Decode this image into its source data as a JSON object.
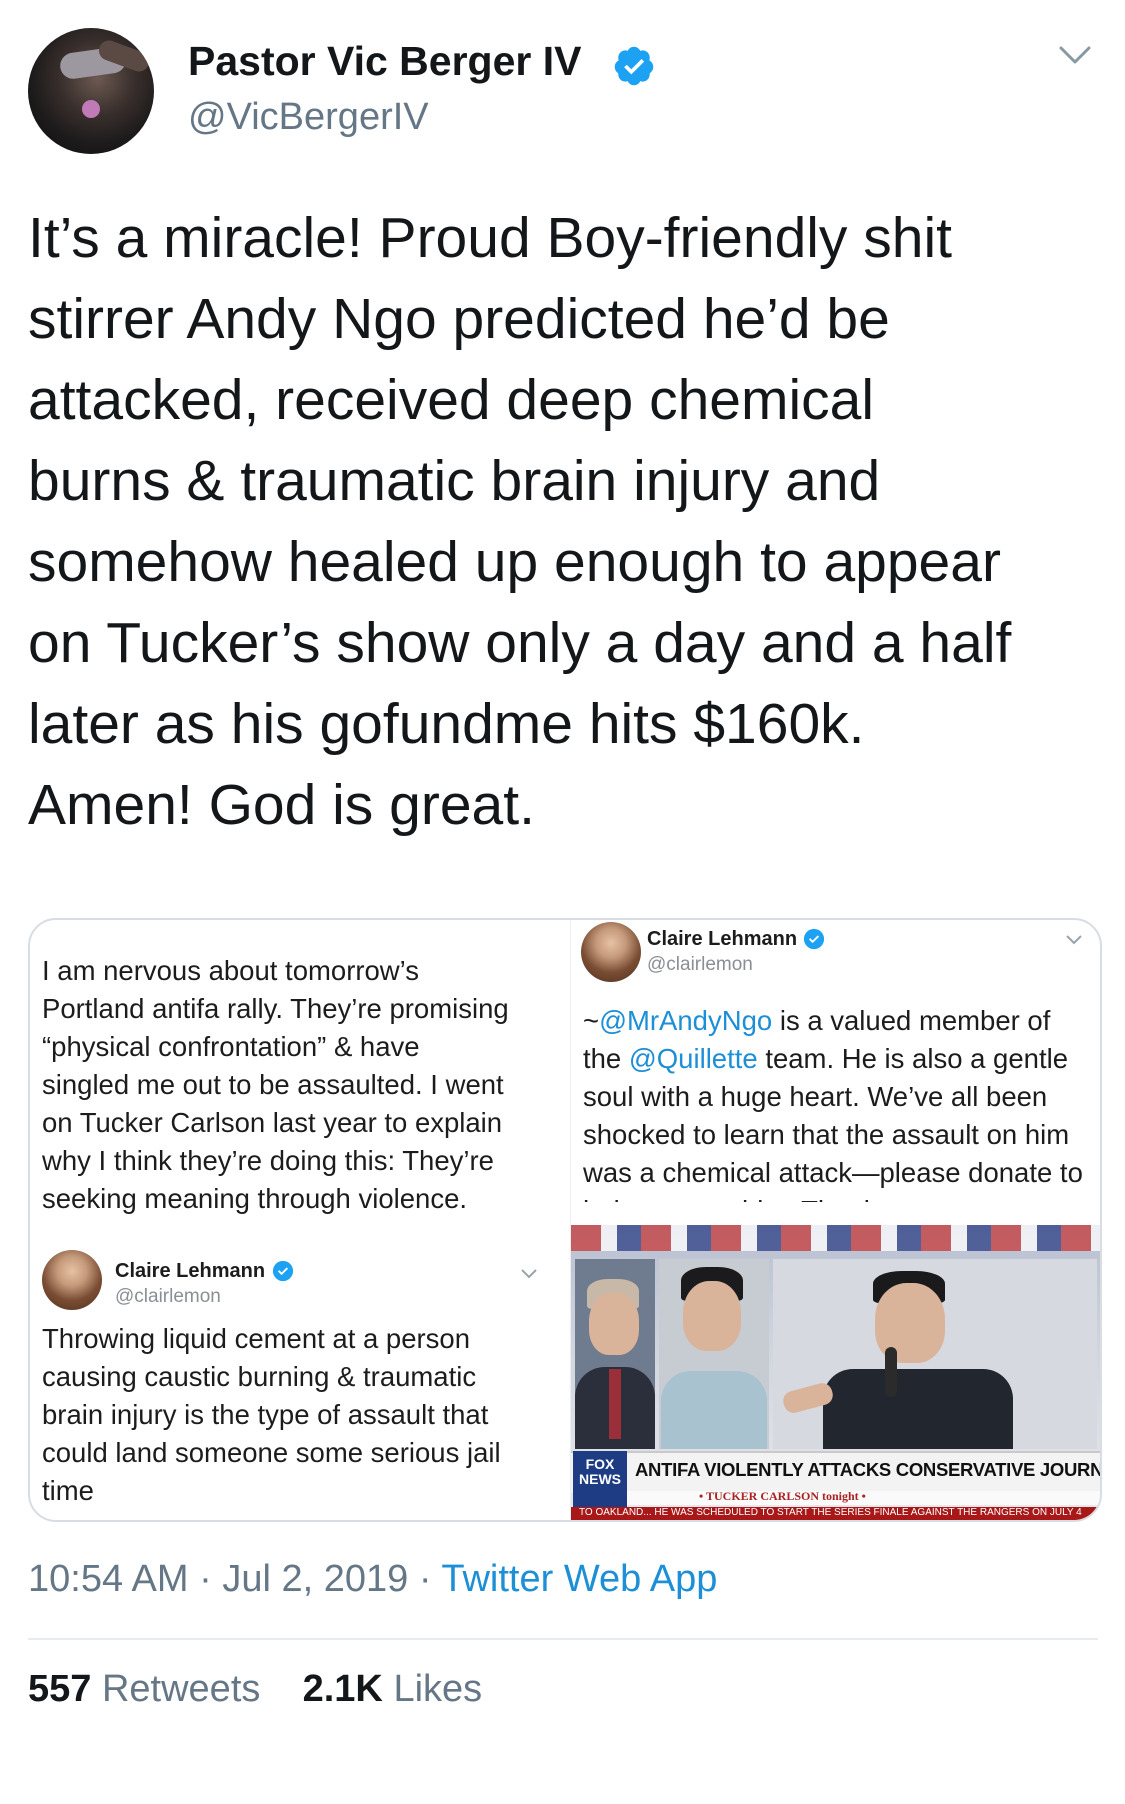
{
  "author": {
    "display_name": "Pastor Vic Berger IV",
    "handle": "@VicBergerIV"
  },
  "tweet": {
    "text": "It’s a miracle! Proud Boy-friendly shit\nstirrer Andy Ngo predicted he’d be\nattacked, received deep chemical\nburns & traumatic brain injury and\nsomehow healed up enough to appear\non Tucker’s show only a day and a half\nlater as his gofundme hits $160k.\nAmen! God is great."
  },
  "embedded_left": {
    "top_text": "I am nervous about tomorrow’s\nPortland antifa rally. They’re promising\n“physical confrontation” & have\nsingled me out to be assaulted. I went\non Tucker Carlson last year to explain\nwhy I think they’re doing this: They’re\nseeking meaning through violence.",
    "reply": {
      "name": "Claire Lehmann",
      "handle": "@clairlemon",
      "text": "Throwing liquid cement at a person\ncausing caustic burning & traumatic\nbrain injury is the type of assault that\ncould land someone some serious jail\ntime"
    }
  },
  "embedded_right": {
    "name": "Claire Lehmann",
    "handle": "@clairlemon",
    "text_prefix": "~",
    "mention_1": "@MrAndyNgo",
    "text_mid": " is a valued member of the ",
    "mention_2": "@Quillette",
    "text_rest": " team. He is also a gentle soul with a huge heart. We’ve all been shocked to learn that the assault on him was a chemical attack—please donate to help support him. Thanks",
    "tv": {
      "logo": "FOX NEWS",
      "headline": "ANTIFA VIOLENTLY ATTACKS CONSERVATIVE JOURNALIST",
      "show": "• TUCKER CARLSON tonight •",
      "ticker": "TO OAKLAND...   HE WAS SCHEDULED TO START THE SERIES FINALE AGAINST THE RANGERS ON JULY 4"
    }
  },
  "meta": {
    "time": "10:54 AM",
    "sep1": " · ",
    "date": "Jul 2, 2019",
    "sep2": " · ",
    "source": "Twitter Web App"
  },
  "stats": {
    "retweets_count": "557",
    "retweets_label": "Retweets",
    "likes_count": "2.1K",
    "likes_label": "Likes"
  },
  "colors": {
    "link": "#1d8fd6",
    "verified": "#1da1f2",
    "secondary_text": "#657786"
  }
}
